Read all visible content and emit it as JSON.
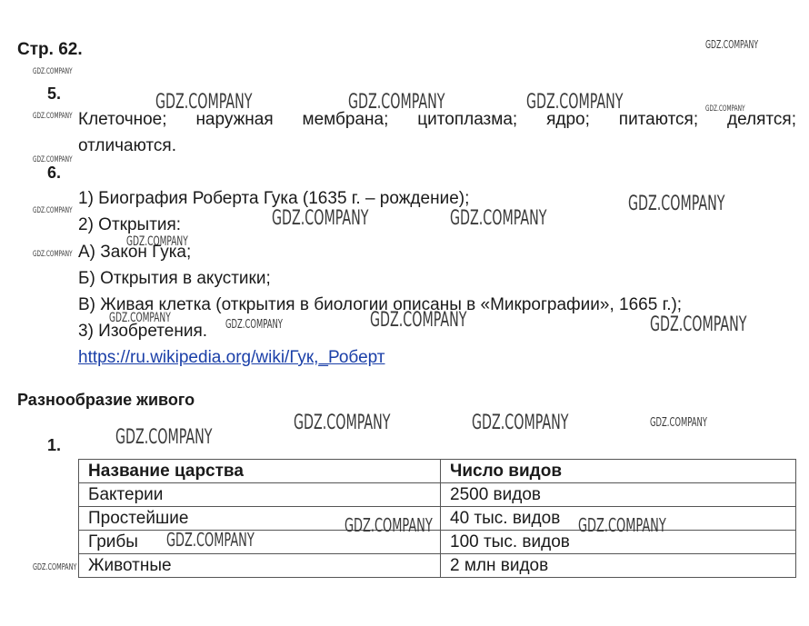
{
  "page_header": "Стр. 62.",
  "tasks": {
    "t5": {
      "number": "5.",
      "line1": "Клеточное; наружная мембрана; цитоплазма; ядро; питаются; делятся;",
      "line2": "отличаются."
    },
    "t6": {
      "number": "6.",
      "lines": [
        "1) Биография Роберта Гука (1635 г. – рождение);",
        "2) Открытия:",
        "А) Закон Гука;",
        "Б) Открытия в акустики;",
        "В) Живая клетка (открытия в биологии описаны в «Микрографии», 1665 г.);",
        "3) Изобретения."
      ],
      "link": "https://ru.wikipedia.org/wiki/Гук,_Роберт"
    }
  },
  "section": {
    "title": "Разнообразие живого",
    "task1_number": "1.",
    "table": {
      "headers": [
        "Название царства",
        "Число видов"
      ],
      "rows": [
        [
          "Бактерии",
          "2500 видов"
        ],
        [
          "Простейшие",
          "40 тыс. видов"
        ],
        [
          "Грибы",
          "100 тыс. видов"
        ],
        [
          "Животные",
          "2 млн видов"
        ]
      ]
    }
  },
  "watermark_text": "GDZ.COMPANY"
}
